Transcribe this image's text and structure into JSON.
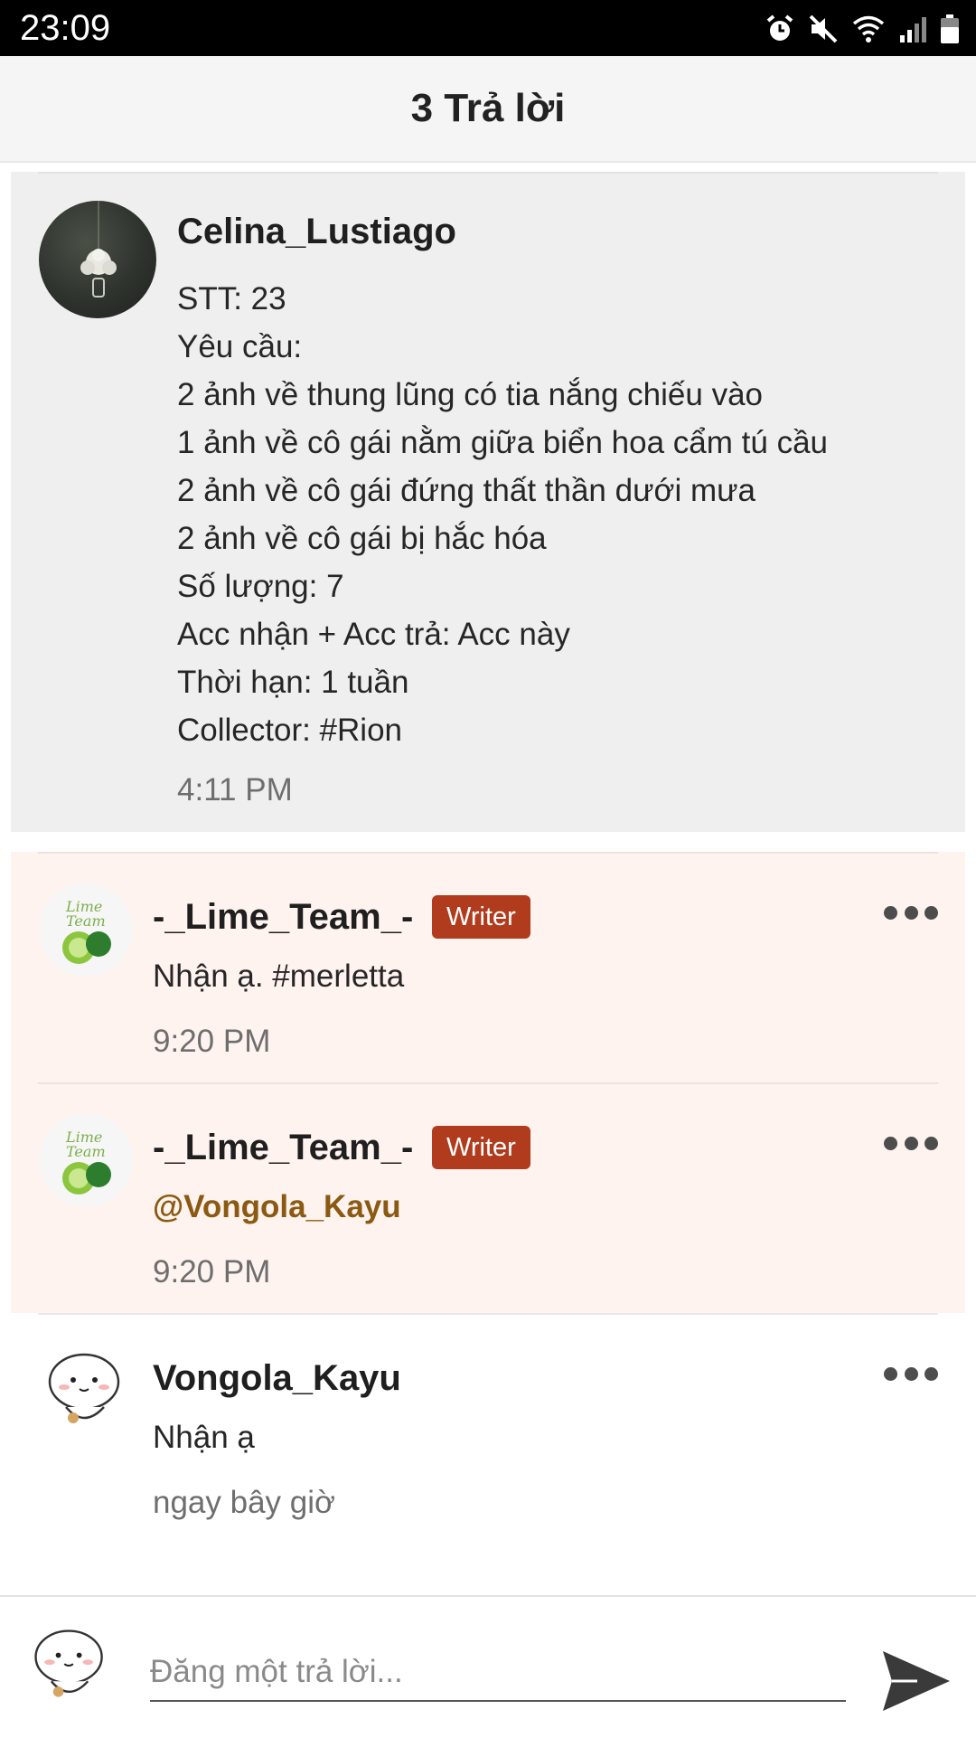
{
  "status_bar": {
    "time": "23:09",
    "icons": [
      "alarm-icon",
      "mute-icon",
      "wifi-icon",
      "signal-icon",
      "battery-icon"
    ]
  },
  "header": {
    "title": "3 Trả lời"
  },
  "original_post": {
    "author": "Celina_Lustiago",
    "lines": [
      "STT: 23",
      "Yêu cầu:",
      "2 ảnh về thung lũng có tia nắng chiếu vào",
      "1 ảnh về cô gái nằm giữa biển hoa cẩm tú cầu",
      "2 ảnh về cô gái đứng thất thần dưới mưa",
      "2 ảnh về cô gái bị hắc hóa",
      "Số lượng: 7",
      "Acc nhận + Acc trả: Acc này",
      "Thời hạn: 1 tuần",
      "Collector: #Rion"
    ],
    "time": "4:11 PM"
  },
  "replies": [
    {
      "author": "-_Lime_Team_-",
      "badge": "Writer",
      "text": "Nhận ạ. #merletta",
      "time": "9:20 PM",
      "highlighted": true
    },
    {
      "author": "-_Lime_Team_-",
      "badge": "Writer",
      "text": "@Vongola_Kayu",
      "time": "9:20 PM",
      "highlighted": true
    },
    {
      "author": "Vongola_Kayu",
      "badge": "",
      "text": "Nhận ạ",
      "time": "ngay bây giờ",
      "highlighted": false
    }
  ],
  "composer": {
    "placeholder": "Đăng một trả lời...",
    "value": ""
  },
  "colors": {
    "badge": "#b13b1d",
    "highlight_bg": "#fff3ef",
    "op_bg": "#efefef",
    "mention": "#8a5a12"
  }
}
